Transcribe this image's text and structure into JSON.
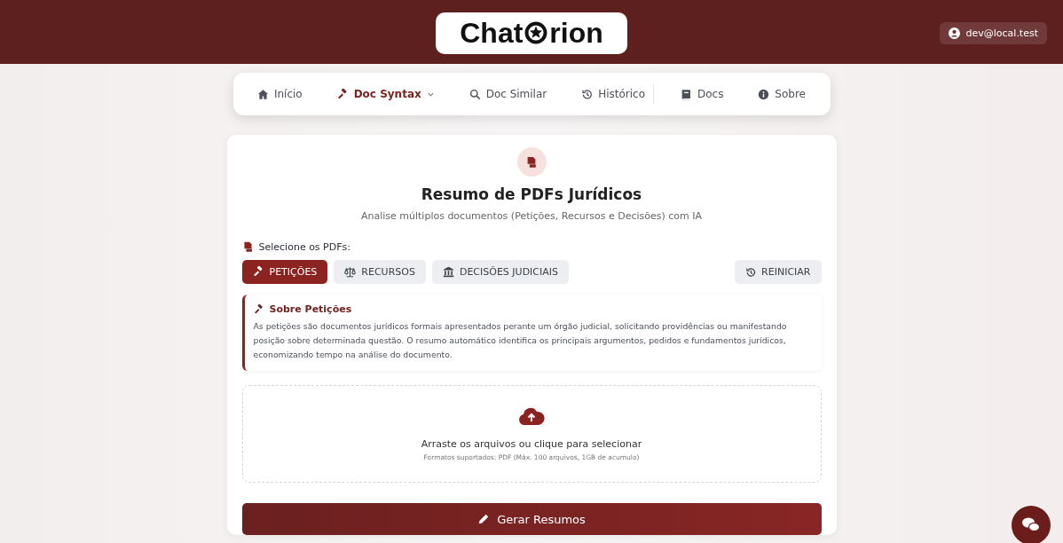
{
  "header": {
    "logo": {
      "before": "Chat",
      "after": "rion"
    },
    "user": "dev@local.test"
  },
  "nav": [
    {
      "label": "Início",
      "selected": false,
      "dropdown": false,
      "divider_before": false
    },
    {
      "label": "Doc Syntax",
      "selected": true,
      "dropdown": true,
      "divider_before": false
    },
    {
      "label": "Doc Similar",
      "selected": false,
      "dropdown": false,
      "divider_before": false
    },
    {
      "label": "Histórico",
      "selected": false,
      "dropdown": false,
      "divider_before": false
    },
    {
      "label": "Docs",
      "selected": false,
      "dropdown": false,
      "divider_before": true
    },
    {
      "label": "Sobre",
      "selected": false,
      "dropdown": false,
      "divider_before": false
    }
  ],
  "main": {
    "title": "Resumo de PDFs Jurídicos",
    "subtitle": "Analise múltiplos documentos (Petições, Recursos e Decisões) com IA",
    "select_label": "Selecione os PDFs:",
    "tabs": [
      {
        "label": "PETIÇÕES",
        "selected": true
      },
      {
        "label": "RECURSOS",
        "selected": false
      },
      {
        "label": "DECISÕES JUDICIAIS",
        "selected": false
      }
    ],
    "reset": "REINICIAR",
    "info": {
      "title": "Sobre Petições",
      "text": "As petições são documentos jurídicos formais apresentados perante um órgão judicial, solicitando providências ou manifestando posição sobre determinada questão. O resumo automático identifica os principais argumentos, pedidos e fundamentos jurídicos, economizando tempo na análise do documento."
    },
    "upload": {
      "title": "Arraste os arquivos ou clique para selecionar",
      "hint": "Formatos suportados: PDF (Máx. 100 arquivos, 1GB de acumulo)"
    },
    "submit": "Gerar Resumos"
  }
}
